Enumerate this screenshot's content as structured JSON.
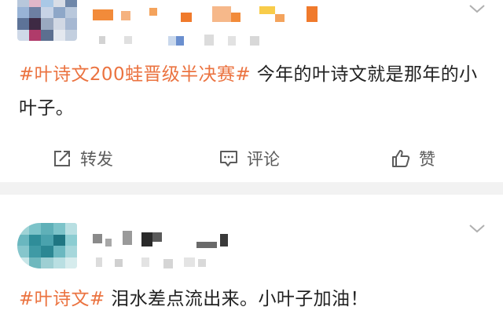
{
  "colors": {
    "topic": "#eb7340",
    "text": "#222222",
    "action_text": "#5b5b5b",
    "separator": "#f2f2f2",
    "chevron": "#b0b0b0"
  },
  "posts": [
    {
      "topic": "#叶诗文200蛙晋级半决赛#",
      "text": " 今年的叶诗文就是那年的小叶子。",
      "actions": {
        "repost_label": "转发",
        "comment_label": "评论",
        "like_label": "赞"
      }
    },
    {
      "topic": "#叶诗文#",
      "text": " 泪水差点流出来。小叶子加油！"
    }
  ],
  "icons": [
    "chevron-down-icon",
    "repost-icon",
    "comment-icon",
    "like-icon"
  ]
}
